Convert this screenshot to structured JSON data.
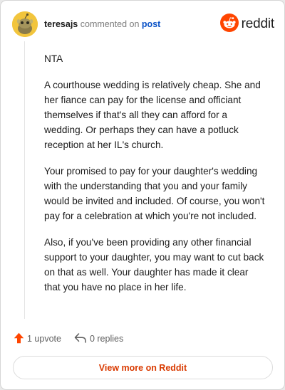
{
  "header": {
    "username": "teresajs",
    "action_text": "commented on",
    "post_link": "post",
    "brand": "reddit"
  },
  "comment": {
    "paragraphs": [
      "NTA",
      "A courthouse wedding is relatively cheap. She and her fiance can pay for the license and officiant themselves if that's all they can afford for a wedding. Or perhaps they can have a potluck reception at her IL's church.",
      "Your promised to pay for your daughter's wedding with the understanding that you and your family would be invited and included. Of course, you won't pay for a celebration at which you're not included.",
      "Also, if you've been providing any other financial support to your daughter, you may want to cut back on that as well. Your daughter has made it clear that you have no place in her life."
    ]
  },
  "actions": {
    "upvote_label": "1 upvote",
    "replies_label": "0 replies"
  },
  "footer": {
    "view_more_label": "View more on Reddit"
  },
  "colors": {
    "brand_orange": "#ff4500",
    "link_blue": "#0a52c7",
    "view_more_text": "#d93a00",
    "avatar_bg": "#f2c53d"
  },
  "icons": {
    "avatar": "snoo-avatar-icon",
    "brand": "reddit-logo-icon",
    "upvote": "upvote-arrow-icon",
    "reply": "reply-arrow-icon"
  }
}
